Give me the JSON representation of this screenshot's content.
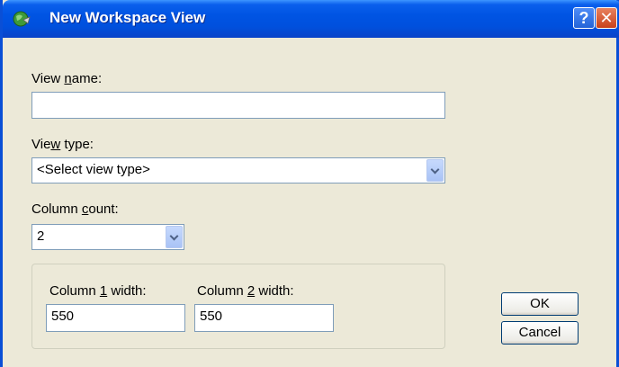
{
  "window": {
    "title": "New Workspace View",
    "help_label": "?",
    "close_label": "✕"
  },
  "form": {
    "view_name": {
      "label_pre": "View ",
      "label_key": "n",
      "label_post": "ame:",
      "value": ""
    },
    "view_type": {
      "label_pre": "Vie",
      "label_key": "w",
      "label_post": " type:",
      "selected": "<Select view type>"
    },
    "column_count": {
      "label_pre": "Column ",
      "label_key": "c",
      "label_post": "ount:",
      "selected": "2"
    },
    "columns": [
      {
        "label_pre": "Column ",
        "label_key": "1",
        "label_post": " width:",
        "value": "550"
      },
      {
        "label_pre": "Column ",
        "label_key": "2",
        "label_post": " width:",
        "value": "550"
      }
    ]
  },
  "buttons": {
    "ok": "OK",
    "cancel": "Cancel"
  },
  "colors": {
    "titlebar": "#0054e3",
    "dialog_bg": "#ece9d8",
    "field_border": "#7f9db9"
  },
  "icons": {
    "app": "globe-icon",
    "help": "help-icon",
    "close": "close-icon",
    "dropdown": "chevron-down-icon"
  }
}
